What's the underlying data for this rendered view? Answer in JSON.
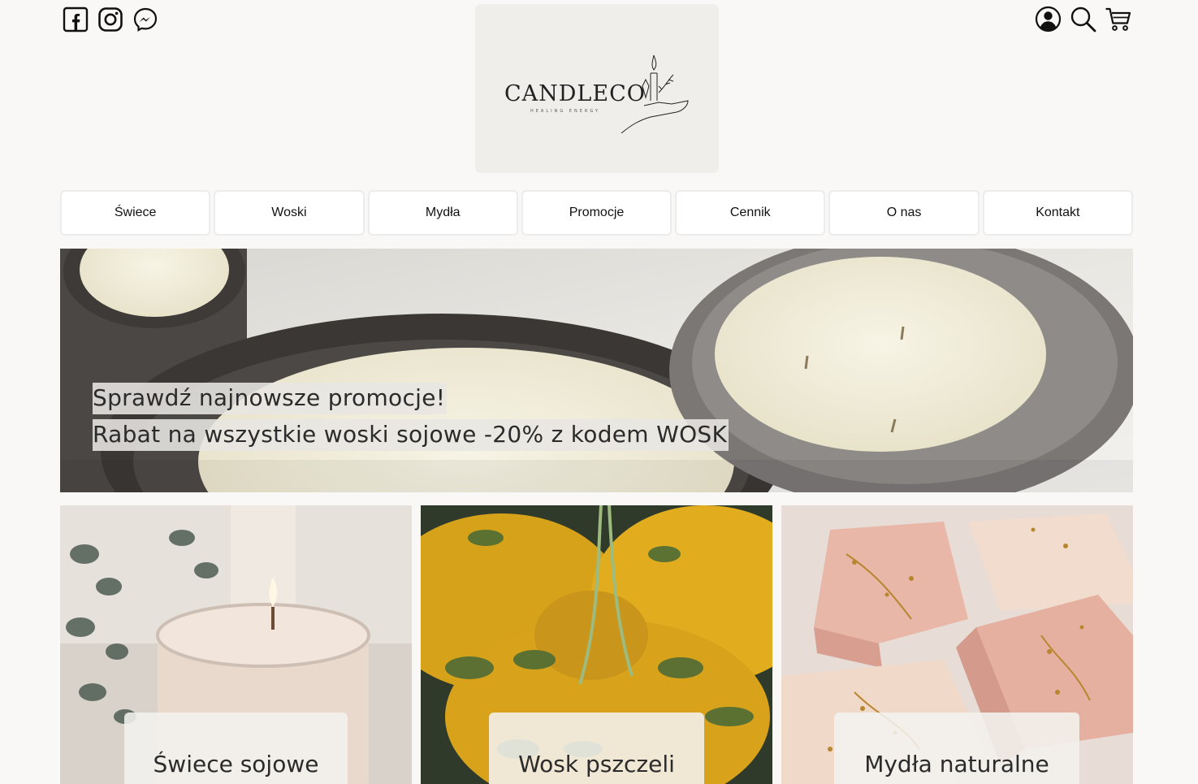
{
  "header": {
    "social_icons": [
      "facebook-icon",
      "instagram-icon",
      "messenger-icon"
    ],
    "tool_icons": [
      "account-icon",
      "search-icon",
      "cart-icon"
    ],
    "logo": {
      "brand": "CANDLECO",
      "tagline": "HEALING ENERGY"
    }
  },
  "nav": {
    "items": [
      {
        "label": "Świece"
      },
      {
        "label": "Woski"
      },
      {
        "label": "Mydła"
      },
      {
        "label": "Promocje"
      },
      {
        "label": "Cennik"
      },
      {
        "label": "O nas"
      },
      {
        "label": "Kontakt"
      }
    ]
  },
  "hero": {
    "line1": "Sprawdź najnowsze promocje!",
    "line2": "Rabat na wszystkie woski sojowe -20% z kodem WOSK"
  },
  "categories": [
    {
      "label": "Świece sojowe"
    },
    {
      "label": "Wosk pszczeli"
    },
    {
      "label": "Mydła naturalne"
    }
  ],
  "colors": {
    "background": "#f9f8f6",
    "logo_bg": "#efeeeb",
    "nav_bg": "#ffffff",
    "text": "#222222"
  }
}
